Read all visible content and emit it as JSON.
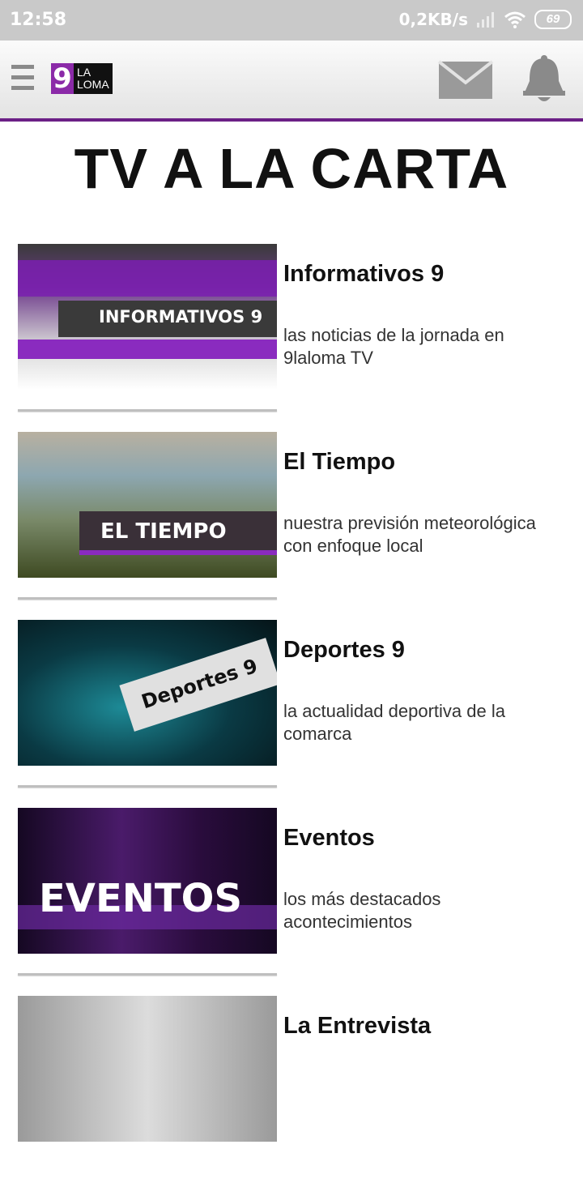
{
  "status_bar": {
    "time": "12:58",
    "speed": "0,2KB/s",
    "battery": "69"
  },
  "header": {
    "logo_number": "9",
    "logo_line1": "LA",
    "logo_line2": "LOMA"
  },
  "page": {
    "title": "TV A LA CARTA"
  },
  "items": [
    {
      "thumb_text": "INFORMATIVOS 9",
      "title": "Informativos 9",
      "desc": "las noticias de la jornada en 9laloma TV"
    },
    {
      "thumb_text": "EL TIEMPO",
      "title": "El Tiempo",
      "desc": "nuestra previsión meteorológica con enfoque local"
    },
    {
      "thumb_text": "Deportes 9",
      "title": "Deportes 9",
      "desc": "la actualidad deportiva de la comarca"
    },
    {
      "thumb_text": "EVENTOS",
      "title": "Eventos",
      "desc": "los más destacados acontecimientos"
    },
    {
      "thumb_text": "",
      "title": "La Entrevista",
      "desc": ""
    }
  ],
  "colors": {
    "accent": "#6b1f86",
    "logo_purple": "#8b2aa8"
  },
  "icons": [
    "menu-icon",
    "mail-icon",
    "bell-icon",
    "signal-icon",
    "wifi-icon",
    "battery-icon"
  ]
}
